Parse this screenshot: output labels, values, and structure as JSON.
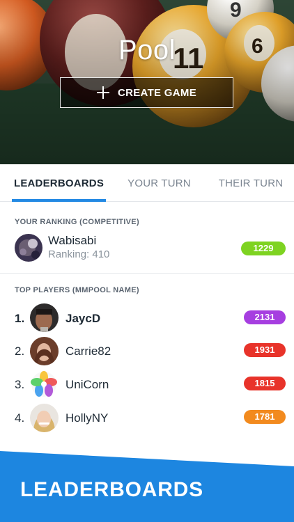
{
  "hero": {
    "title": "Pool",
    "create_label": "CREATE GAME",
    "icon": "plus-icon"
  },
  "tabs": [
    {
      "label": "LEADERBOARDS",
      "active": true
    },
    {
      "label": "YOUR TURN",
      "active": false
    },
    {
      "label": "THEIR TURN",
      "active": false
    }
  ],
  "your_ranking": {
    "header": "YOUR RANKING (COMPETITIVE)",
    "name": "Wabisabi",
    "ranking": "Ranking: 410",
    "score": "1229",
    "score_color": "#7ed321"
  },
  "top_players": {
    "header": "TOP PLAYERS (MMPOOL NAME)",
    "rows": [
      {
        "rank": "1.",
        "name": "JaycD",
        "score": "2131",
        "color": "#a63ee0"
      },
      {
        "rank": "2.",
        "name": "Carrie82",
        "score": "1931",
        "color": "#e8332a"
      },
      {
        "rank": "3.",
        "name": "UniCorn",
        "score": "1815",
        "color": "#e8332a"
      },
      {
        "rank": "4.",
        "name": "HollyNY",
        "score": "1781",
        "color": "#f28a1e"
      }
    ]
  },
  "footer": {
    "banner_text": "LEADERBOARDS",
    "color": "#1d86e0"
  },
  "colors": {
    "accent": "#2389e3"
  }
}
